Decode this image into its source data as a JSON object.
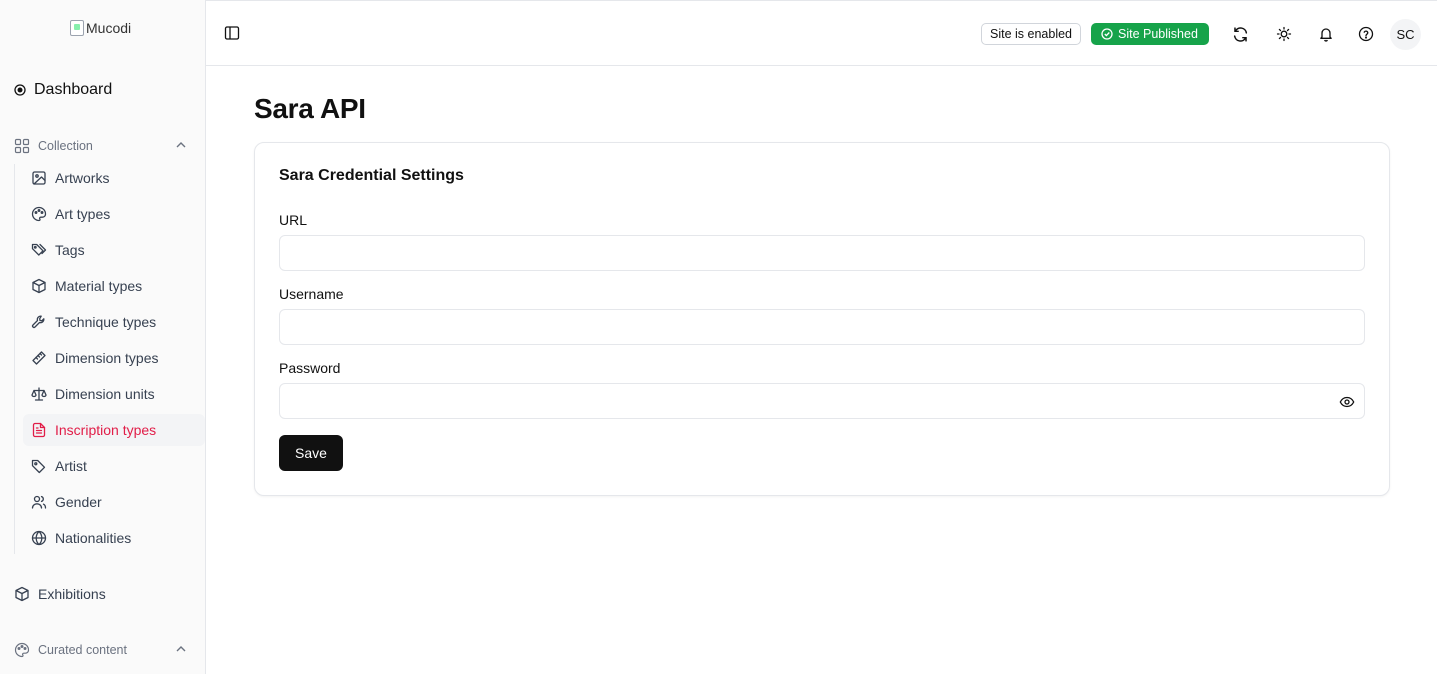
{
  "sidebar": {
    "logo_text": "Mucodi",
    "dashboard_label": "Dashboard",
    "collection_label": "Collection",
    "items": [
      {
        "label": "Artworks",
        "icon": "image-icon"
      },
      {
        "label": "Art types",
        "icon": "palette-icon"
      },
      {
        "label": "Tags",
        "icon": "tags-icon"
      },
      {
        "label": "Material types",
        "icon": "box-icon"
      },
      {
        "label": "Technique types",
        "icon": "wrench-icon"
      },
      {
        "label": "Dimension types",
        "icon": "ruler-icon"
      },
      {
        "label": "Dimension units",
        "icon": "scale-icon"
      },
      {
        "label": "Inscription types",
        "icon": "file-text-icon"
      },
      {
        "label": "Artist",
        "icon": "tag-icon"
      },
      {
        "label": "Gender",
        "icon": "users-icon"
      },
      {
        "label": "Nationalities",
        "icon": "globe-icon"
      }
    ],
    "active_item": "Inscription types",
    "exhibitions_label": "Exhibitions",
    "curated_label": "Curated content"
  },
  "header": {
    "site_enabled_label": "Site is enabled",
    "site_published_label": "Site Published",
    "avatar_initials": "SC"
  },
  "main": {
    "title": "Sara API",
    "card_title": "Sara Credential Settings",
    "url_label": "URL",
    "url_value": "",
    "username_label": "Username",
    "username_value": "",
    "password_label": "Password",
    "password_value": "",
    "save_label": "Save"
  },
  "colors": {
    "accent": "#e11d48",
    "published_green": "#16a34a",
    "primary_button": "#111111"
  }
}
